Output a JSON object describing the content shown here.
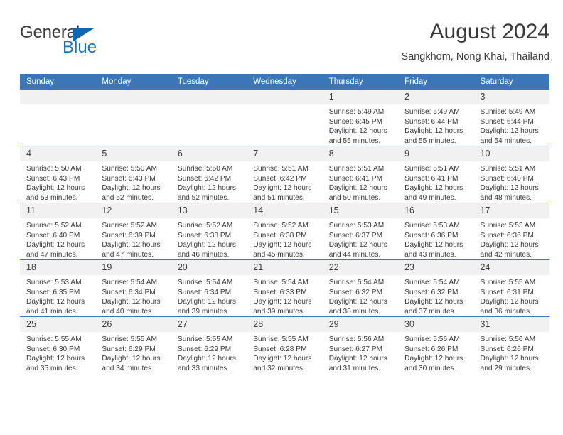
{
  "brand": {
    "name_top": "General",
    "name_bottom": "Blue",
    "accent_color": "#1b75bc"
  },
  "header": {
    "title": "August 2024",
    "subtitle": "Sangkhom, Nong Khai, Thailand"
  },
  "calendar": {
    "header_color": "#3b77b8",
    "daynum_background": "#f1f1f1",
    "weekday_headers": [
      "Sunday",
      "Monday",
      "Tuesday",
      "Wednesday",
      "Thursday",
      "Friday",
      "Saturday"
    ],
    "labels": {
      "sunrise": "Sunrise:",
      "sunset": "Sunset:",
      "daylight": "Daylight:"
    },
    "weeks": [
      [
        {
          "day": ""
        },
        {
          "day": ""
        },
        {
          "day": ""
        },
        {
          "day": ""
        },
        {
          "day": "1",
          "sunrise": "Sunrise: 5:49 AM",
          "sunset": "Sunset: 6:45 PM",
          "daylight_1": "Daylight: 12 hours",
          "daylight_2": "and 55 minutes."
        },
        {
          "day": "2",
          "sunrise": "Sunrise: 5:49 AM",
          "sunset": "Sunset: 6:44 PM",
          "daylight_1": "Daylight: 12 hours",
          "daylight_2": "and 55 minutes."
        },
        {
          "day": "3",
          "sunrise": "Sunrise: 5:49 AM",
          "sunset": "Sunset: 6:44 PM",
          "daylight_1": "Daylight: 12 hours",
          "daylight_2": "and 54 minutes."
        }
      ],
      [
        {
          "day": "4",
          "sunrise": "Sunrise: 5:50 AM",
          "sunset": "Sunset: 6:43 PM",
          "daylight_1": "Daylight: 12 hours",
          "daylight_2": "and 53 minutes."
        },
        {
          "day": "5",
          "sunrise": "Sunrise: 5:50 AM",
          "sunset": "Sunset: 6:43 PM",
          "daylight_1": "Daylight: 12 hours",
          "daylight_2": "and 52 minutes."
        },
        {
          "day": "6",
          "sunrise": "Sunrise: 5:50 AM",
          "sunset": "Sunset: 6:42 PM",
          "daylight_1": "Daylight: 12 hours",
          "daylight_2": "and 52 minutes."
        },
        {
          "day": "7",
          "sunrise": "Sunrise: 5:51 AM",
          "sunset": "Sunset: 6:42 PM",
          "daylight_1": "Daylight: 12 hours",
          "daylight_2": "and 51 minutes."
        },
        {
          "day": "8",
          "sunrise": "Sunrise: 5:51 AM",
          "sunset": "Sunset: 6:41 PM",
          "daylight_1": "Daylight: 12 hours",
          "daylight_2": "and 50 minutes."
        },
        {
          "day": "9",
          "sunrise": "Sunrise: 5:51 AM",
          "sunset": "Sunset: 6:41 PM",
          "daylight_1": "Daylight: 12 hours",
          "daylight_2": "and 49 minutes."
        },
        {
          "day": "10",
          "sunrise": "Sunrise: 5:51 AM",
          "sunset": "Sunset: 6:40 PM",
          "daylight_1": "Daylight: 12 hours",
          "daylight_2": "and 48 minutes."
        }
      ],
      [
        {
          "day": "11",
          "sunrise": "Sunrise: 5:52 AM",
          "sunset": "Sunset: 6:40 PM",
          "daylight_1": "Daylight: 12 hours",
          "daylight_2": "and 47 minutes."
        },
        {
          "day": "12",
          "sunrise": "Sunrise: 5:52 AM",
          "sunset": "Sunset: 6:39 PM",
          "daylight_1": "Daylight: 12 hours",
          "daylight_2": "and 47 minutes."
        },
        {
          "day": "13",
          "sunrise": "Sunrise: 5:52 AM",
          "sunset": "Sunset: 6:38 PM",
          "daylight_1": "Daylight: 12 hours",
          "daylight_2": "and 46 minutes."
        },
        {
          "day": "14",
          "sunrise": "Sunrise: 5:52 AM",
          "sunset": "Sunset: 6:38 PM",
          "daylight_1": "Daylight: 12 hours",
          "daylight_2": "and 45 minutes."
        },
        {
          "day": "15",
          "sunrise": "Sunrise: 5:53 AM",
          "sunset": "Sunset: 6:37 PM",
          "daylight_1": "Daylight: 12 hours",
          "daylight_2": "and 44 minutes."
        },
        {
          "day": "16",
          "sunrise": "Sunrise: 5:53 AM",
          "sunset": "Sunset: 6:36 PM",
          "daylight_1": "Daylight: 12 hours",
          "daylight_2": "and 43 minutes."
        },
        {
          "day": "17",
          "sunrise": "Sunrise: 5:53 AM",
          "sunset": "Sunset: 6:36 PM",
          "daylight_1": "Daylight: 12 hours",
          "daylight_2": "and 42 minutes."
        }
      ],
      [
        {
          "day": "18",
          "sunrise": "Sunrise: 5:53 AM",
          "sunset": "Sunset: 6:35 PM",
          "daylight_1": "Daylight: 12 hours",
          "daylight_2": "and 41 minutes."
        },
        {
          "day": "19",
          "sunrise": "Sunrise: 5:54 AM",
          "sunset": "Sunset: 6:34 PM",
          "daylight_1": "Daylight: 12 hours",
          "daylight_2": "and 40 minutes."
        },
        {
          "day": "20",
          "sunrise": "Sunrise: 5:54 AM",
          "sunset": "Sunset: 6:34 PM",
          "daylight_1": "Daylight: 12 hours",
          "daylight_2": "and 39 minutes."
        },
        {
          "day": "21",
          "sunrise": "Sunrise: 5:54 AM",
          "sunset": "Sunset: 6:33 PM",
          "daylight_1": "Daylight: 12 hours",
          "daylight_2": "and 39 minutes."
        },
        {
          "day": "22",
          "sunrise": "Sunrise: 5:54 AM",
          "sunset": "Sunset: 6:32 PM",
          "daylight_1": "Daylight: 12 hours",
          "daylight_2": "and 38 minutes."
        },
        {
          "day": "23",
          "sunrise": "Sunrise: 5:54 AM",
          "sunset": "Sunset: 6:32 PM",
          "daylight_1": "Daylight: 12 hours",
          "daylight_2": "and 37 minutes."
        },
        {
          "day": "24",
          "sunrise": "Sunrise: 5:55 AM",
          "sunset": "Sunset: 6:31 PM",
          "daylight_1": "Daylight: 12 hours",
          "daylight_2": "and 36 minutes."
        }
      ],
      [
        {
          "day": "25",
          "sunrise": "Sunrise: 5:55 AM",
          "sunset": "Sunset: 6:30 PM",
          "daylight_1": "Daylight: 12 hours",
          "daylight_2": "and 35 minutes."
        },
        {
          "day": "26",
          "sunrise": "Sunrise: 5:55 AM",
          "sunset": "Sunset: 6:29 PM",
          "daylight_1": "Daylight: 12 hours",
          "daylight_2": "and 34 minutes."
        },
        {
          "day": "27",
          "sunrise": "Sunrise: 5:55 AM",
          "sunset": "Sunset: 6:29 PM",
          "daylight_1": "Daylight: 12 hours",
          "daylight_2": "and 33 minutes."
        },
        {
          "day": "28",
          "sunrise": "Sunrise: 5:55 AM",
          "sunset": "Sunset: 6:28 PM",
          "daylight_1": "Daylight: 12 hours",
          "daylight_2": "and 32 minutes."
        },
        {
          "day": "29",
          "sunrise": "Sunrise: 5:56 AM",
          "sunset": "Sunset: 6:27 PM",
          "daylight_1": "Daylight: 12 hours",
          "daylight_2": "and 31 minutes."
        },
        {
          "day": "30",
          "sunrise": "Sunrise: 5:56 AM",
          "sunset": "Sunset: 6:26 PM",
          "daylight_1": "Daylight: 12 hours",
          "daylight_2": "and 30 minutes."
        },
        {
          "day": "31",
          "sunrise": "Sunrise: 5:56 AM",
          "sunset": "Sunset: 6:26 PM",
          "daylight_1": "Daylight: 12 hours",
          "daylight_2": "and 29 minutes."
        }
      ]
    ]
  }
}
